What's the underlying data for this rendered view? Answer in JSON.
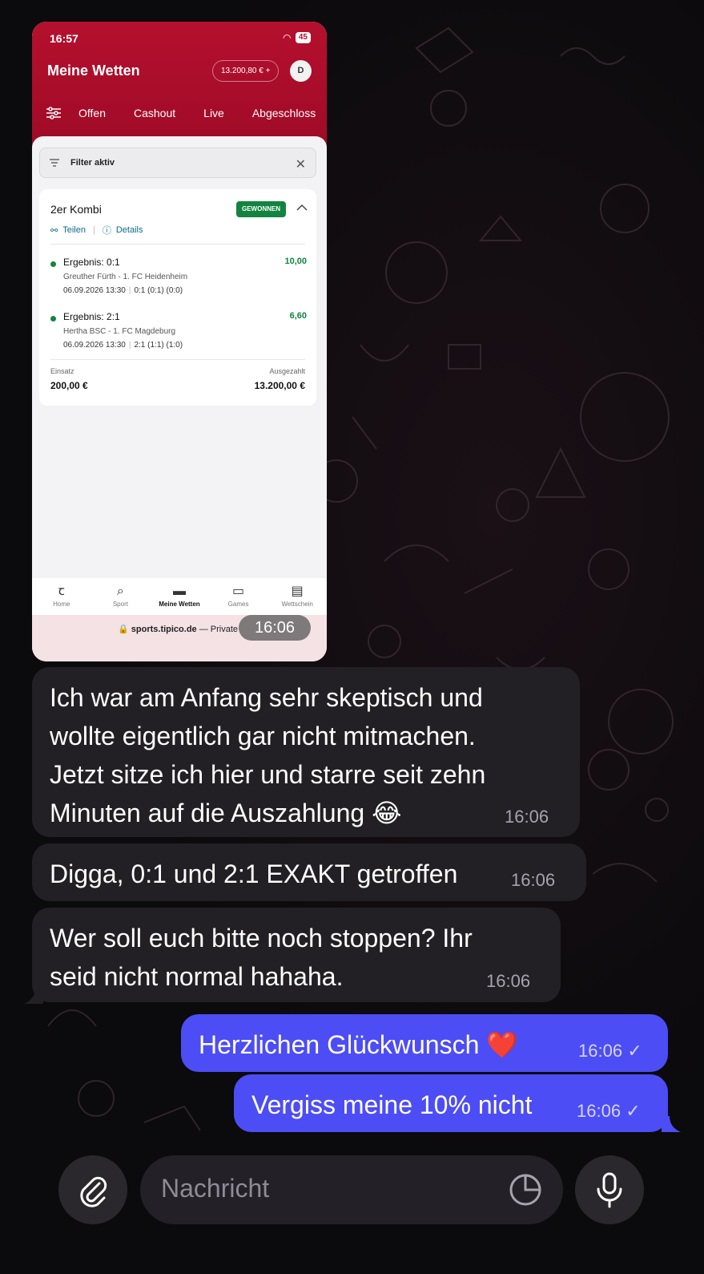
{
  "screenshot": {
    "status_time": "16:57",
    "battery": "45",
    "app_title": "Meine Wetten",
    "balance": "13.200,80 € +",
    "avatar_initial": "D",
    "tabs": [
      "Offen",
      "Cashout",
      "Live",
      "Abgeschloss"
    ],
    "filter_label": "Filter aktiv",
    "bet": {
      "type": "2er Kombi",
      "status": "GEWONNEN",
      "share_label": "Teilen",
      "details_label": "Details",
      "legs": [
        {
          "result": "Ergebnis: 0:1",
          "odds": "10,00",
          "teams": "Greuther Fürth - 1. FC Heidenheim",
          "date": "06.09.2026 13:30",
          "score": "0:1 (0:1) (0:0)"
        },
        {
          "result": "Ergebnis: 2:1",
          "odds": "6,60",
          "teams": "Hertha BSC - 1. FC Magdeburg",
          "date": "06.09.2026 13:30",
          "score": "2:1 (1:1) (1:0)"
        }
      ],
      "stake_label": "Einsatz",
      "stake_value": "200,00 €",
      "payout_label": "Ausgezahlt",
      "payout_value": "13.200,00 €"
    },
    "nav": [
      "Home",
      "Sport",
      "Meine Wetten",
      "Games",
      "Wettschein"
    ],
    "url_domain": "sports.tipico.de",
    "url_suffix": "— Private",
    "image_time": "16:06"
  },
  "messages": [
    {
      "direction": "incoming",
      "text": "Ich war am Anfang sehr skeptisch und\nwollte eigentlich gar nicht mitmachen.\nJetzt sitze ich hier und starre seit zehn\nMinuten auf die Auszahlung 😂",
      "time": "16:06"
    },
    {
      "direction": "incoming",
      "text": "Digga, 0:1 und 2:1 EXAKT getroffen",
      "time": "16:06"
    },
    {
      "direction": "incoming",
      "text": "Wer soll euch bitte noch stoppen? Ihr\nseid nicht normal hahaha.",
      "time": "16:06"
    },
    {
      "direction": "outgoing",
      "text": "Herzlichen Glückwunsch ❤️",
      "time": "16:06",
      "check": "✓"
    },
    {
      "direction": "outgoing",
      "text": "Vergiss meine 10% nicht",
      "time": "16:06",
      "check": "✓"
    }
  ],
  "composer": {
    "placeholder": "Nachricht"
  },
  "colors": {
    "tipico_red": "#b5102e",
    "won_green": "#12843f",
    "outgoing_bubble": "#4d4df5",
    "incoming_bubble": "#222025"
  }
}
